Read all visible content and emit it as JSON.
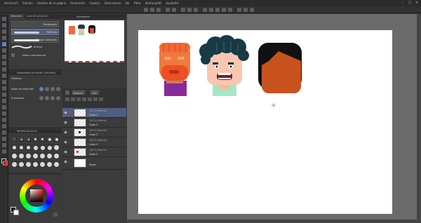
{
  "menubar": {
    "items": [
      "Archivo(F)",
      "Edición",
      "Gestión de la página",
      "Animación",
      "Capa(L)",
      "Selecciones",
      "Ver",
      "Filtro",
      "Ventana(W)",
      "Ayuda(H)"
    ]
  },
  "subtool": {
    "tabs": [
      "Selección",
      "Lazo de selección"
    ],
    "items": [
      {
        "label": "Rectángulo",
        "selected": false
      },
      {
        "label": "Polilínea",
        "selected": true
      },
      {
        "label": "Dibujar selección",
        "selected": false
      }
    ],
    "option_label": "Modo subtramento",
    "brush_label": "Brocha"
  },
  "toolprop": {
    "header": "Propiedades de herram. [Polilínea]",
    "tool_name": "Polilínea",
    "rows": [
      {
        "label": "Modo de selección"
      },
      {
        "label": "Suavizado"
      }
    ]
  },
  "brushsize": {
    "header": "Tamaño del pincel"
  },
  "navigator": {
    "header": "Navegador"
  },
  "layers": {
    "blend_mode": "Normal",
    "opacity": "100",
    "rows": [
      {
        "name": "Capa 1",
        "mode": "100 % Normal",
        "selected": true,
        "has_dot": true
      },
      {
        "name": "Capa 2",
        "mode": "100 % Normal",
        "selected": false,
        "has_dot": false
      },
      {
        "name": "Capa 3",
        "mode": "100 % Normal",
        "selected": false,
        "has_dot": true
      },
      {
        "name": "Capa 4",
        "mode": "100 % Normal",
        "selected": false,
        "has_dot": false
      },
      {
        "name": "Capa 5",
        "mode": "100 % Normal",
        "selected": false,
        "has_dot": true
      },
      {
        "name": "Papel",
        "mode": "",
        "selected": false,
        "has_dot": false
      }
    ]
  },
  "colors": {
    "main": "#111111",
    "sub": "#ffffff",
    "accent": "#5c86c8"
  }
}
